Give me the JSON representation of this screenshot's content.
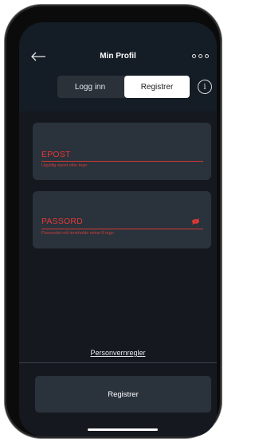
{
  "header": {
    "title": "Min Profil",
    "back_icon": "arrow-left-icon",
    "more_icon": "three-dots-icon",
    "info_icon": "info-icon",
    "info_glyph": "i"
  },
  "tabs": [
    {
      "label": "Logg inn",
      "selected": false
    },
    {
      "label": "Registrer",
      "selected": true
    }
  ],
  "form": {
    "email": {
      "label": "EPOST",
      "error": "Ugyldig epost eller tegn"
    },
    "password": {
      "label": "PASSORD",
      "error": "Passordet må inneholde minst 6 tegn",
      "visibility_icon": "eye-off-icon"
    }
  },
  "footer": {
    "privacy_link": "Personvernregler",
    "register_button": "Registrer"
  },
  "colors": {
    "background": "#15191f",
    "header": "#141c25",
    "card": "#2a323c",
    "error": "#e53a33",
    "selected_tab": "#ffffff"
  }
}
